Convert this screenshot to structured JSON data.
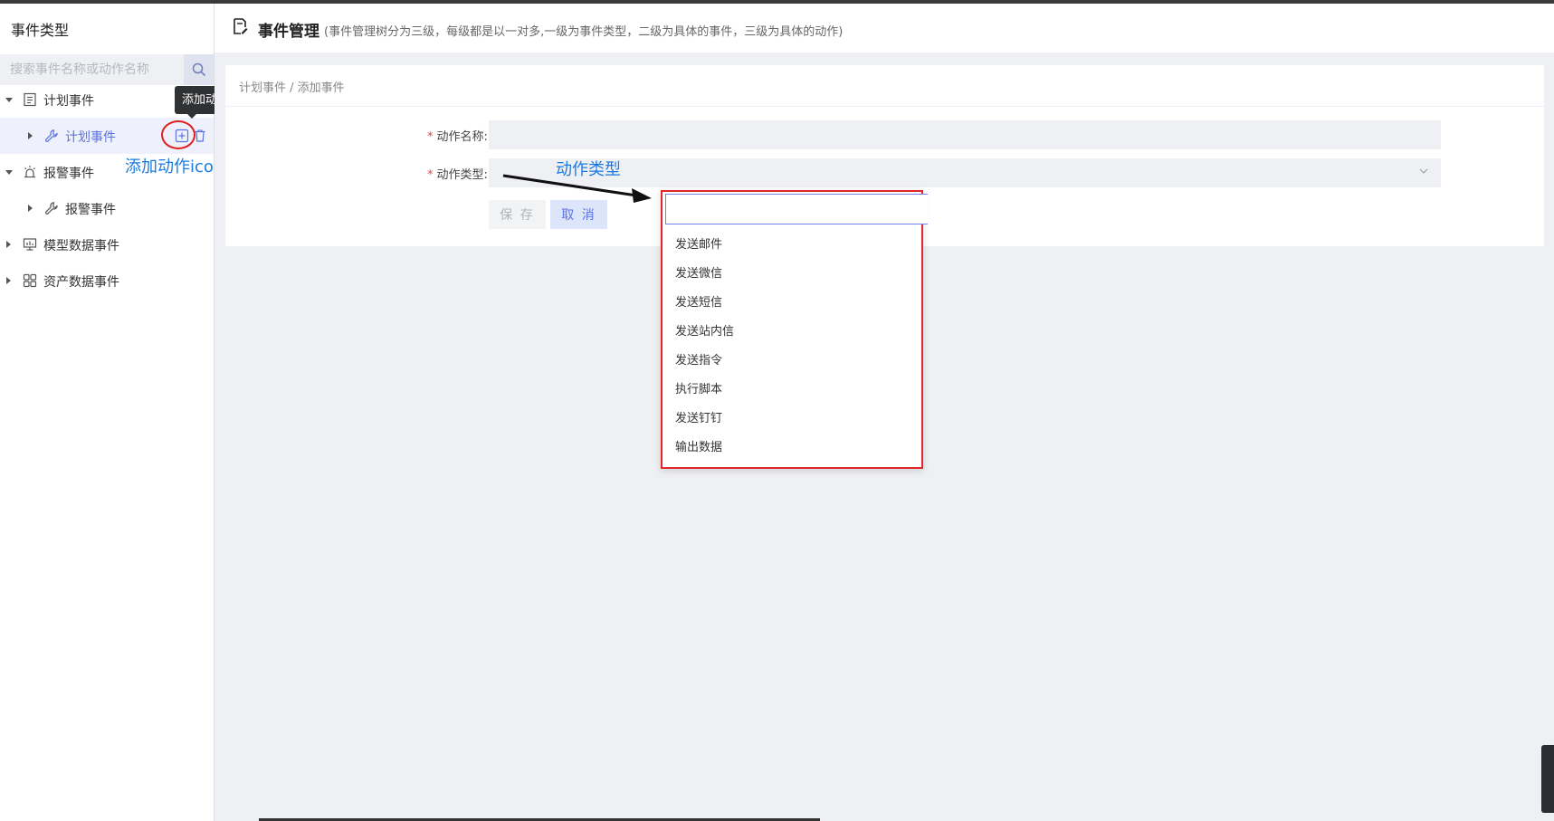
{
  "sidebar": {
    "title": "事件类型",
    "search": {
      "placeholder": "搜索事件名称或动作名称",
      "value": ""
    },
    "tree": [
      {
        "label": "计划事件",
        "level": 1,
        "expanded": true,
        "icon": "document-list-icon"
      },
      {
        "label": "计划事件",
        "level": 2,
        "expanded": false,
        "icon": "wrench-icon",
        "active": true
      },
      {
        "label": "报警事件",
        "level": 1,
        "expanded": true,
        "icon": "alarm-light-icon"
      },
      {
        "label": "报警事件",
        "level": 2,
        "expanded": false,
        "icon": "wrench-icon"
      },
      {
        "label": "模型数据事件",
        "level": 1,
        "expanded": false,
        "icon": "monitor-chart-icon"
      },
      {
        "label": "资产数据事件",
        "level": 1,
        "expanded": false,
        "icon": "grid-apps-icon"
      }
    ],
    "node_actions": {
      "add_icon": "plus-square-icon",
      "delete_icon": "trash-icon"
    },
    "tooltip": "添加动作"
  },
  "annotations": {
    "add_action_icon": "添加动作icon",
    "action_type": "动作类型"
  },
  "header": {
    "icon": "edit-document-icon",
    "title": "事件管理",
    "description": "(事件管理树分为三级，每级都是以一对多,一级为事件类型，二级为具体的事件，三级为具体的动作)"
  },
  "breadcrumb": "计划事件 / 添加事件",
  "form": {
    "action_name_label": "动作名称:",
    "action_name_value": "",
    "action_type_label": "动作类型:",
    "action_type_value": "",
    "save_label": "保 存",
    "cancel_label": "取 消"
  },
  "dropdown": {
    "options": [
      "发送邮件",
      "发送微信",
      "发送短信",
      "发送站内信",
      "发送指令",
      "执行脚本",
      "发送钉钉",
      "输出数据"
    ]
  },
  "colors": {
    "accent": "#5a74e0",
    "annotation": "#1a7be0",
    "highlight_border": "#e02828",
    "required": "#e84040"
  }
}
